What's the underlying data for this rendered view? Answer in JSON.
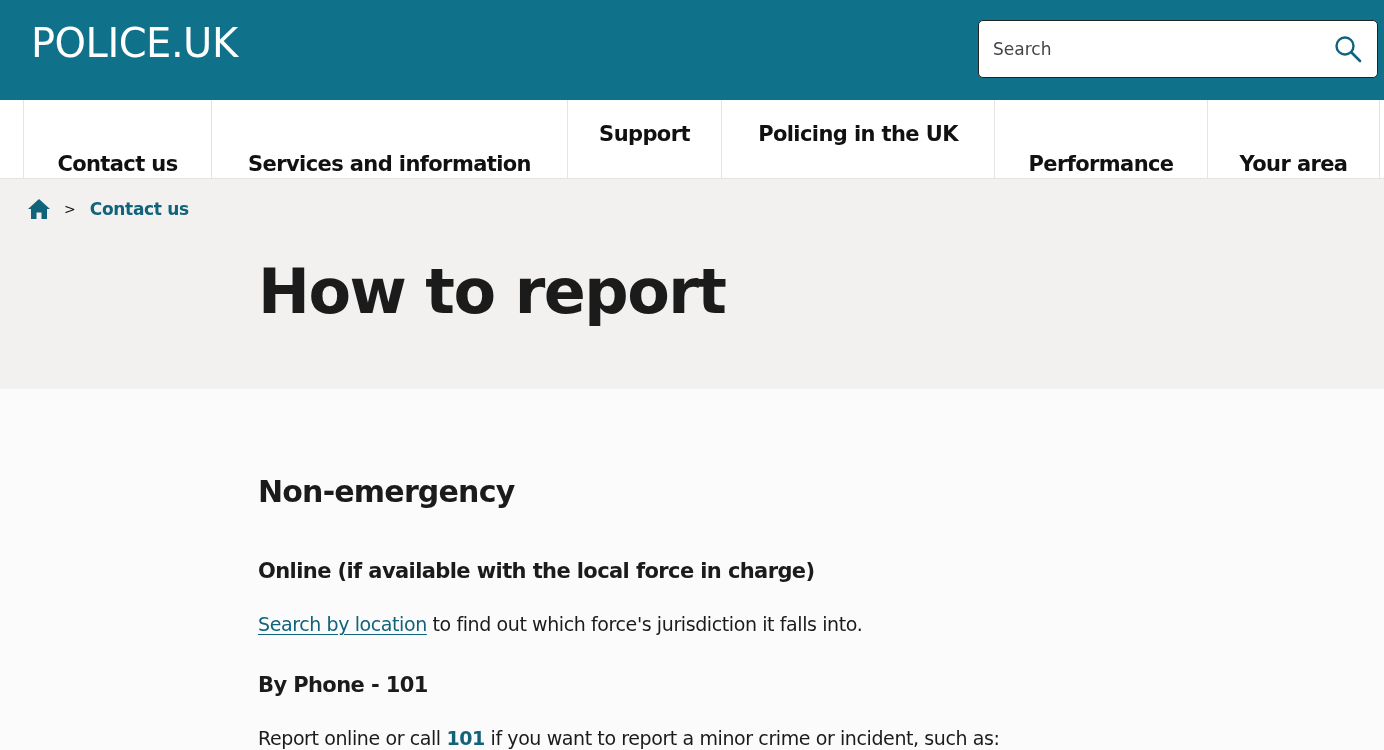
{
  "header": {
    "logo": "POLICE.UK",
    "search": {
      "placeholder": "Search"
    }
  },
  "nav": [
    {
      "label": "Contact us",
      "kind": "low"
    },
    {
      "label": "Services and information",
      "kind": "low"
    },
    {
      "label": "Support",
      "kind": "high"
    },
    {
      "label": "Policing in the UK",
      "kind": "high"
    },
    {
      "label": "Performance",
      "kind": "low"
    },
    {
      "label": "Your area",
      "kind": "low"
    }
  ],
  "breadcrumb": {
    "separator": ">",
    "items": [
      "Contact us"
    ]
  },
  "page_title": "How to report",
  "content": [
    {
      "kind": "h2",
      "text": "Non-emergency"
    },
    {
      "kind": "h3",
      "text": "Online (if available with the local force in charge)"
    },
    {
      "kind": "p",
      "parts": [
        {
          "kind": "link",
          "text": "Search by location"
        },
        {
          "kind": "text",
          "text": " to find out which force's jurisdiction it falls into."
        }
      ]
    },
    {
      "kind": "h3",
      "text": "By Phone - 101"
    },
    {
      "kind": "p",
      "parts": [
        {
          "kind": "text",
          "text": "Report online or call "
        },
        {
          "kind": "phone",
          "text": "101"
        },
        {
          "kind": "text",
          "text": " if you want to report a minor crime or incident, such as:"
        }
      ]
    }
  ]
}
